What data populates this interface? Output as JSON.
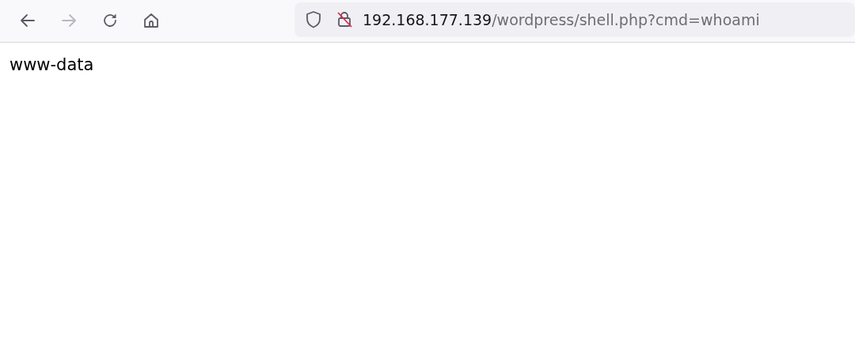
{
  "toolbar": {
    "buttons": [
      {
        "kind": "back",
        "disabled": false
      },
      {
        "kind": "forward",
        "disabled": true
      },
      {
        "kind": "reload",
        "disabled": false
      },
      {
        "kind": "home",
        "disabled": false
      }
    ]
  },
  "address_bar": {
    "host": "192.168.177.139",
    "path": "/wordpress/shell.php?cmd=whoami"
  },
  "page": {
    "text": "www-data"
  }
}
